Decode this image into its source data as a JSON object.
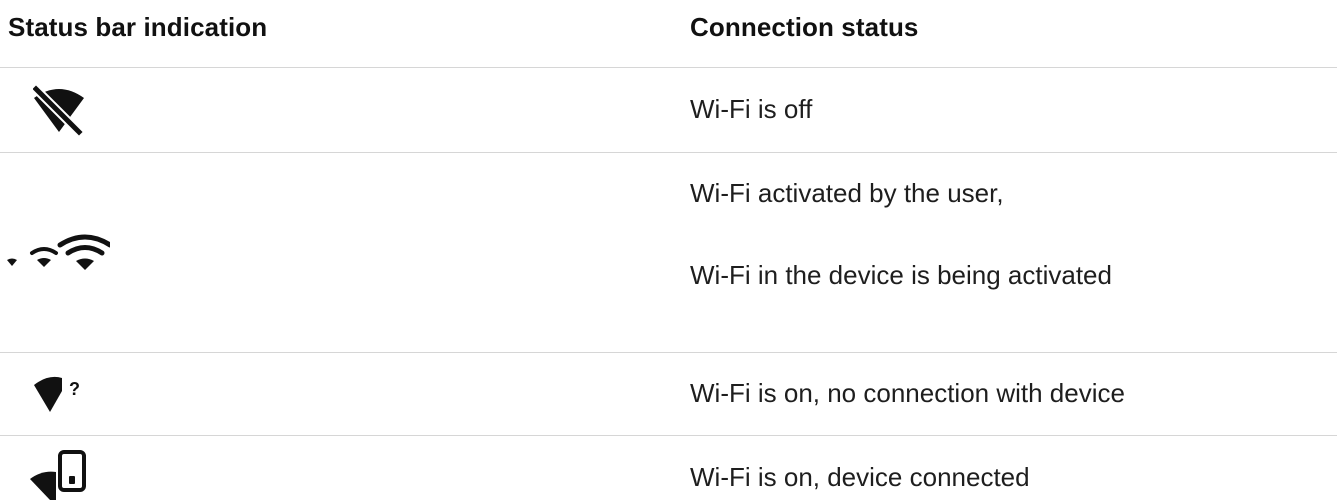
{
  "table": {
    "headers": {
      "indication": "Status bar indication",
      "connection": "Connection status"
    },
    "rows": [
      {
        "icon": "wifi-off-icon",
        "status": [
          "Wi-Fi is off"
        ]
      },
      {
        "icon": "wifi-activating-icon",
        "status": [
          "Wi-Fi activated by the user,",
          "Wi-Fi in the device is being activated"
        ]
      },
      {
        "icon": "wifi-no-connection-icon",
        "status": [
          "Wi-Fi is on, no connection with device"
        ]
      },
      {
        "icon": "wifi-device-connected-icon",
        "status": [
          "Wi-Fi is on, device connected"
        ]
      }
    ]
  },
  "colors": {
    "text": "#1a1a1a",
    "divider": "#d6d6d6",
    "icon": "#111111"
  }
}
